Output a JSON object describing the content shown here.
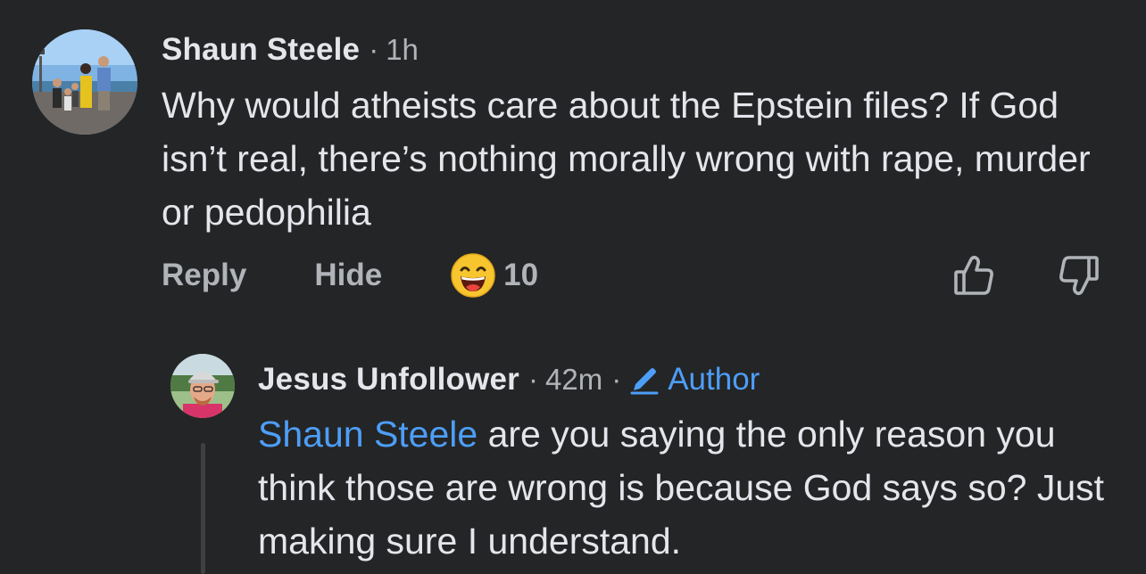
{
  "comment": {
    "author": "Shaun Steele",
    "separator": "·",
    "time": "1h",
    "text": "Why would atheists care about the Epstein files? If God isn’t real, there’s nothing morally wrong with rape, murder or pedophilia",
    "actions": {
      "reply_label": "Reply",
      "hide_label": "Hide",
      "reaction_icon": "grinning-face-emoji",
      "reaction_count": "10"
    },
    "icons": {
      "upvote": "thumbs-up-icon",
      "downvote": "thumbs-down-icon"
    }
  },
  "reply": {
    "author": "Jesus Unfollower",
    "separator": "·",
    "time": "42m",
    "separator2": "·",
    "author_badge_icon": "pencil-icon",
    "author_badge": "Author",
    "mention": "Shaun Steele",
    "text": " are you saying the only reason you think those are wrong is because God says so? Just making sure I understand."
  },
  "colors": {
    "background": "#242526",
    "primary_text": "#e4e6eb",
    "secondary_text": "#b0b3b8",
    "accent": "#4d9ef7"
  }
}
